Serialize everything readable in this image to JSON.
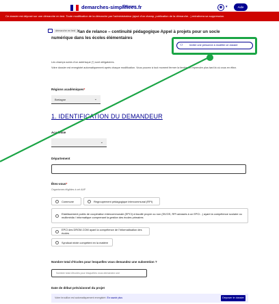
{
  "header": {
    "brand": "demarches-simplifiees.fr",
    "brand_sub": "Dossiers",
    "user_icon": "user-icon",
    "help_label": "Aide"
  },
  "banner": {
    "text": "Ce dossier est déposé sur une démarche en test. Toute modification de la démarche par l'administrateur (ajout d'un champ, publication de la démarche...) entraînera sa suppression."
  },
  "dossier": {
    "badge": "démarche en test",
    "title": "Plan de relance – continuité pédagogique Appel à projets pour un socle numérique dans les écoles élémentaires",
    "invite_label": "Inviter une personne à modifier ce dossier"
  },
  "intro": {
    "required_note": "Les champs suivis d'un astérisque (*) sont obligatoires.",
    "autosave_note": "Votre dossier est enregistré automatiquement après chaque modification. Vous pouvez à tout moment fermer la fenêtre et reprendre plus tard là où vous en étiez."
  },
  "region": {
    "label": "Régions académiques",
    "value": "Bretagne"
  },
  "section": {
    "title": "1. IDENTIFICATION DU DEMANDEUR"
  },
  "academie": {
    "label": "Académie",
    "value": ""
  },
  "departement": {
    "label": "Département",
    "value": ""
  },
  "etes_vous": {
    "label": "Êtes-vous",
    "hint": "Organismes éligibles à cet AAP",
    "options": [
      "Commune",
      "Regroupement pédagogique intercommunal (RPI)",
      "Etablissement public de coopération intercommunale (EPCI) à faculté propre ou non (SIVOS, RPI adossés à un EPCI...) ayant la compétence scolaire ou multimédia / informatique comprenant la gestion des écoles primaires",
      "EPCI des DROM-COM ayant la compétence de l'informatisation des écoles",
      "Syndicat mixte compétent en la matière"
    ]
  },
  "nb_ecoles": {
    "label": "Nombre total d'écoles pour lesquelles vous demandez une subvention ?",
    "placeholder": "Nombre total d'écoles pour lesquelles vous demandez une"
  },
  "date_debut": {
    "label": "Date de début prévisionnel du projet"
  },
  "footer": {
    "autosave": "Votre brouillon est automatiquement enregistré.",
    "more_link": "En savoir plus",
    "submit": "Déposer le dossier"
  },
  "colors": {
    "brand": "#000091",
    "banner": "#ce0500",
    "highlight": "#1aa545"
  }
}
